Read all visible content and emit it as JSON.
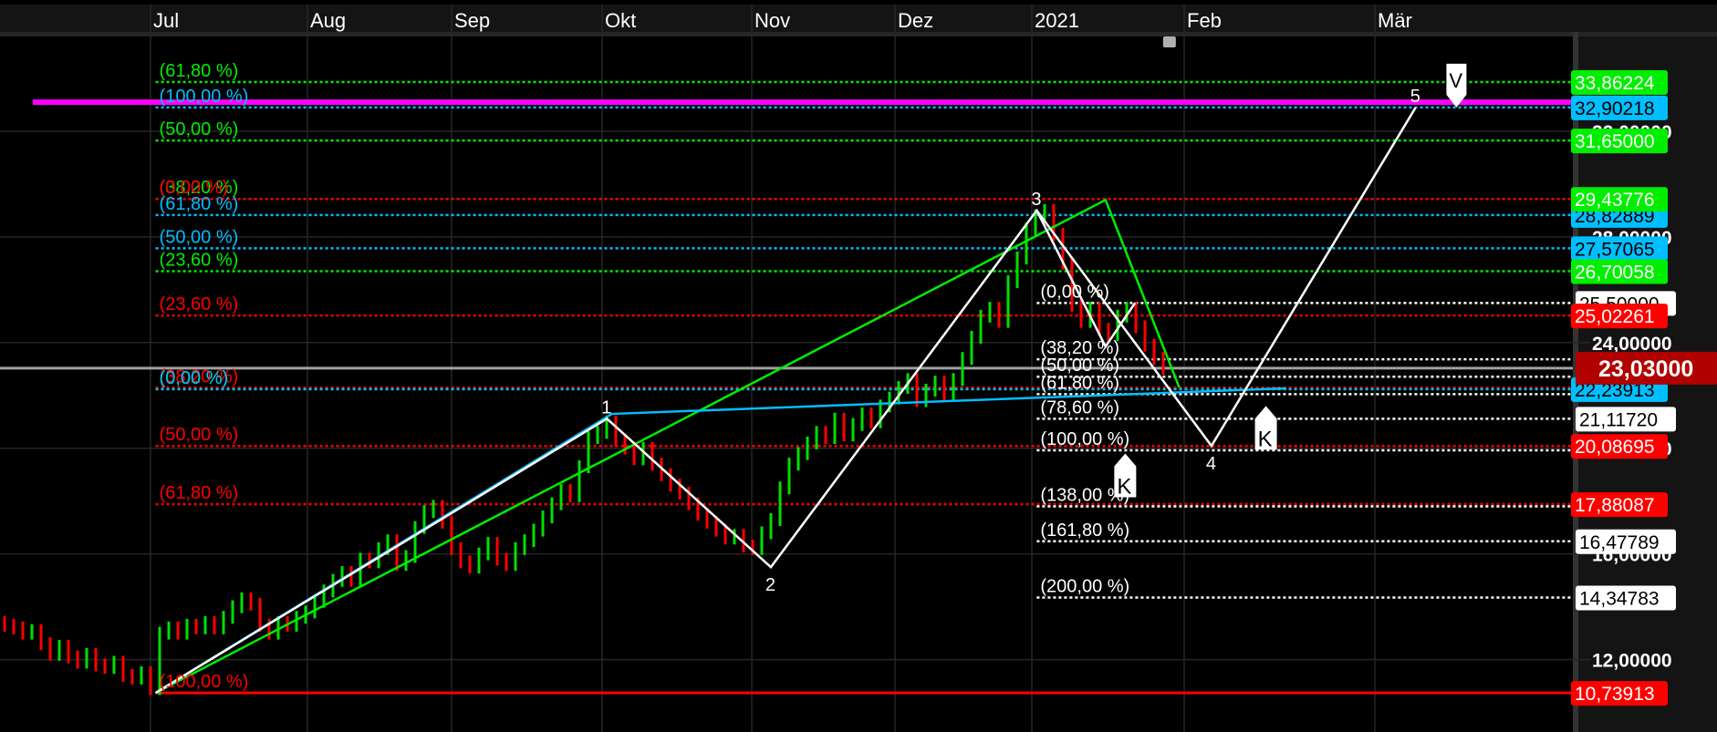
{
  "chart_data": {
    "type": "candlestick",
    "x_ticks": [
      "Jul",
      "Aug",
      "Sep",
      "Okt",
      "Nov",
      "Dez",
      "2021",
      "Feb",
      "Mär"
    ],
    "y_ticks": [
      "12,00000",
      "16,00000",
      "20,00000",
      "24,00000",
      "28,00000",
      "32,00000"
    ],
    "y_tick_values": [
      12,
      16,
      20,
      24,
      28,
      32
    ],
    "ylim": [
      9.7,
      35.5
    ],
    "grid": true,
    "colors": {
      "up": "#00e000",
      "down": "#ff0000",
      "green": "#00ee00",
      "blue": "#00bfff",
      "red": "#ff0000",
      "white": "#ffffff",
      "magenta": "#ff00ff",
      "current": "#b00000",
      "price_line": "#a0a0a0"
    },
    "first_open": 13.4,
    "closes": [
      13.3,
      13.2,
      13.0,
      13.1,
      12.6,
      12.2,
      12.5,
      12.1,
      11.9,
      12.2,
      11.8,
      11.7,
      11.9,
      11.4,
      11.3,
      11.5,
      10.9,
      13.0,
      13.2,
      13.0,
      13.3,
      13.2,
      13.4,
      13.2,
      13.6,
      14.0,
      14.3,
      14.1,
      13.3,
      13.0,
      13.4,
      13.3,
      13.6,
      13.8,
      14.2,
      14.6,
      15.0,
      15.3,
      15.0,
      15.8,
      15.7,
      16.2,
      16.5,
      15.6,
      15.9,
      17.0,
      17.6,
      17.8,
      17.2,
      16.2,
      15.7,
      15.5,
      16.0,
      16.4,
      15.8,
      15.6,
      16.2,
      16.5,
      16.9,
      17.4,
      17.9,
      18.4,
      18.2,
      19.3,
      20.4,
      20.6,
      21.0,
      20.3,
      20.0,
      19.6,
      20.0,
      19.4,
      19.0,
      18.6,
      18.3,
      17.9,
      17.5,
      17.2,
      16.9,
      16.6,
      16.7,
      16.3,
      16.2,
      16.8,
      17.3,
      18.5,
      19.4,
      19.8,
      20.2,
      20.6,
      20.4,
      21.1,
      20.5,
      20.9,
      21.3,
      21.0,
      21.6,
      21.9,
      22.3,
      22.6,
      21.8,
      22.2,
      22.5,
      22.0,
      22.6,
      23.4,
      24.2,
      25.0,
      25.3,
      24.8,
      26.3,
      27.2,
      28.3,
      28.8,
      29.0,
      28.1,
      27.0,
      25.4,
      24.8,
      25.3,
      24.5,
      24.3,
      25.0,
      25.3,
      24.6,
      23.9,
      23.4,
      23.03
    ],
    "current_price": {
      "value": 23.03,
      "label": "23,03000"
    },
    "magenta_line": {
      "value": 33.1,
      "from": "2020-06-07"
    },
    "fib_sets": [
      {
        "name": "green",
        "color": "#00ee00",
        "from": "2020-07-02",
        "levels": [
          {
            "label": "(61,80 %)",
            "value": 33.86224,
            "axis": "33,86224"
          },
          {
            "label": "(50,00 %)",
            "value": 31.65,
            "axis": "31,65000"
          },
          {
            "label": "(38,20 %)",
            "value": 29.43776,
            "axis": "29,43776"
          },
          {
            "label": "(23,60 %)",
            "value": 26.70058,
            "axis": "26,70058"
          },
          {
            "label": "(0,00 %)",
            "value": 22.23913,
            "axis": ""
          }
        ]
      },
      {
        "name": "red",
        "color": "#ff0000",
        "from": "2020-07-02",
        "levels": [
          {
            "label": "(0,00 %)",
            "value": 29.43776,
            "axis": ""
          },
          {
            "label": "(23,60 %)",
            "value": 25.02261,
            "axis": "25,02261"
          },
          {
            "label": "(38,20 %)",
            "value": 22.29,
            "axis": ""
          },
          {
            "label": "(50,00 %)",
            "value": 20.08695,
            "axis": "20,08695"
          },
          {
            "label": "(61,80 %)",
            "value": 17.88087,
            "axis": "17,88087"
          },
          {
            "label": "(100,00 %)",
            "value": 10.73913,
            "axis": "10,73913",
            "solid": true
          }
        ]
      },
      {
        "name": "blue",
        "color": "#00bfff",
        "from": "2020-07-02",
        "levels": [
          {
            "label": "(100,00 %)",
            "value": 32.90218,
            "axis": "32,90218"
          },
          {
            "label": "(61,80 %)",
            "value": 28.82889,
            "axis": "28,82889"
          },
          {
            "label": "(50,00 %)",
            "value": 27.57065,
            "axis": "27,57065"
          },
          {
            "label": "(0,00 %)",
            "value": 22.23913,
            "axis": "22,23913"
          }
        ]
      },
      {
        "name": "white",
        "color": "#ffffff",
        "from": "2021-01-02",
        "levels": [
          {
            "label": "(0,00 %)",
            "value": 25.5,
            "axis": "25,50000"
          },
          {
            "label": "(38,20 %)",
            "value": 23.37,
            "axis": ""
          },
          {
            "label": "(50,00 %)",
            "value": 22.71,
            "axis": ""
          },
          {
            "label": "(61,80 %)",
            "value": 22.05,
            "axis": ""
          },
          {
            "label": "(78,60 %)",
            "value": 21.1172,
            "axis": "21,11720"
          },
          {
            "label": "(100,00 %)",
            "value": 19.92,
            "axis": ""
          },
          {
            "label": "(138,00 %)",
            "value": 17.8,
            "axis": ""
          },
          {
            "label": "(161,80 %)",
            "value": 16.47789,
            "axis": "16,47789"
          },
          {
            "label": "(200,00 %)",
            "value": 14.34783,
            "axis": "14,34783"
          }
        ]
      }
    ],
    "elliott_wave": {
      "color": "#ffffff",
      "points": [
        {
          "date": "2020-07-02",
          "value": 10.74,
          "label": ""
        },
        {
          "date": "2020-10-02",
          "value": 21.12,
          "label": "1"
        },
        {
          "date": "2020-11-05",
          "value": 15.5,
          "label": "2"
        },
        {
          "date": "2021-01-02",
          "value": 29.0,
          "label": "3"
        },
        {
          "date": "2021-02-05",
          "value": 20.09,
          "label": "4"
        },
        {
          "date": "2021-03-07",
          "value": 32.9,
          "label": "5"
        }
      ]
    },
    "sub_wave": {
      "color": "#ffffff",
      "points": [
        {
          "date": "2021-01-02",
          "value": 29.0
        },
        {
          "date": "2021-01-16",
          "value": 23.85
        },
        {
          "date": "2021-01-22",
          "value": 25.5
        }
      ]
    },
    "green_line": {
      "color": "#00ee00",
      "points": [
        {
          "date": "2020-07-02",
          "value": 10.74
        },
        {
          "date": "2021-01-16",
          "value": 29.4
        },
        {
          "date": "2021-01-31",
          "value": 22.3
        }
      ]
    },
    "blue_line": {
      "color": "#00bfff",
      "points": [
        {
          "date": "2020-07-02",
          "value": 10.74
        },
        {
          "date": "2020-10-03",
          "value": 21.3
        },
        {
          "date": "2021-02-16",
          "value": 22.27
        }
      ]
    },
    "markers": [
      {
        "type": "down",
        "label": "V",
        "date": "2021-03-13",
        "value": 32.9
      },
      {
        "type": "up",
        "label": "K",
        "date": "2021-02-13",
        "value": 21.6
      },
      {
        "type": "up",
        "label": "K",
        "date": "2021-01-20",
        "value": 19.8
      }
    ]
  }
}
